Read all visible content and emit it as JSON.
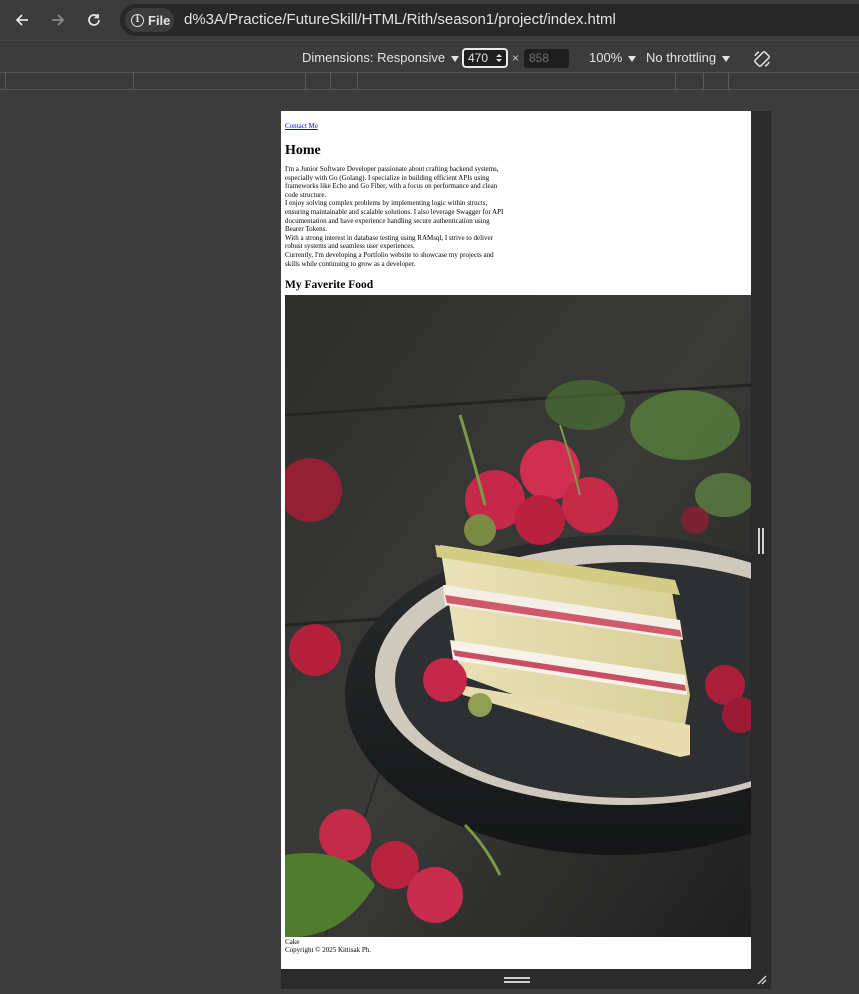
{
  "browser": {
    "url_chip_label": "File",
    "url": "d%3A/Practice/FutureSkill/HTML/Rith/season1/project/index.html"
  },
  "devtools": {
    "dimensions_label": "Dimensions: Responsive",
    "width_value": "470",
    "times": "×",
    "height_placeholder": "858",
    "zoom_label": "100%",
    "throttling_label": "No throttling"
  },
  "page": {
    "contact_link": "Contact Me",
    "home_heading": "Home",
    "about_paragraphs": [
      "I'm a Junior Software Developer passionate about crafting backend systems, especially with Go (Golang). I specialize in building efficient APIs using frameworks like Echo and Go Fiber, with a focus on performance and clean code structure.",
      "I enjoy solving complex problems by implementing logic within structs, ensuring maintainable and scalable solutions. I also leverage Swagger for API documentation and have experience handling secure authentication using Bearer Tokens.",
      "With a strong interest in database testing using RAMsql, I strive to deliver robust systems and seamless user experiences.",
      "Currently, I'm developing a Portfolio website to showcase my projects and skills while continuing to grow as a developer."
    ],
    "food_heading": "My Faverite Food",
    "food_image_alt": "Cake",
    "caption": "Cake",
    "copyright": "Copyright © 2025 Kittisak Ph."
  },
  "colors": {
    "chrome_bg": "#3c3c3c",
    "omnibox_bg": "#282828",
    "link": "#0000ee"
  }
}
